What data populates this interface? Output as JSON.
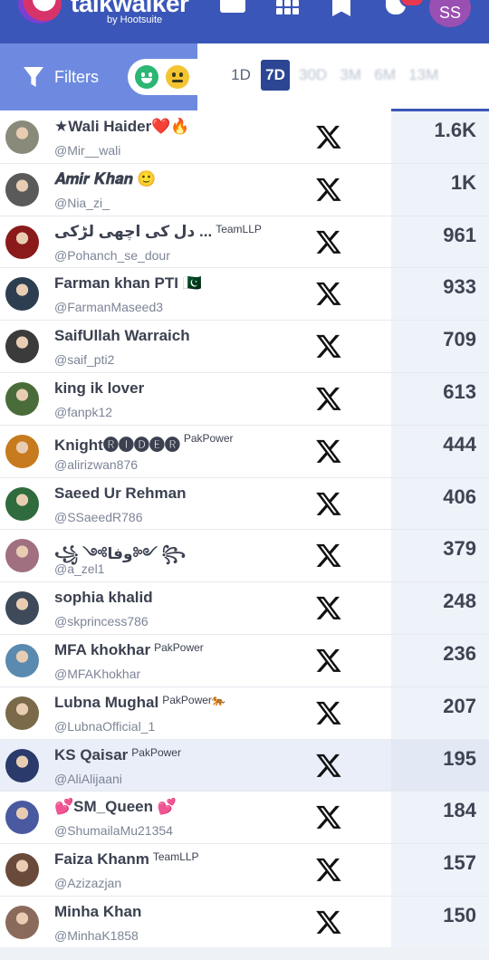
{
  "header": {
    "brand": "talkwalker",
    "brand_sub": "by Hootsuite",
    "avatar_initials": "SS"
  },
  "filters": {
    "label": "Filters",
    "ranges": [
      {
        "label": "1D",
        "state": "normal"
      },
      {
        "label": "7D",
        "state": "active"
      },
      {
        "label": "30D",
        "state": "muted"
      },
      {
        "label": "3M",
        "state": "muted"
      },
      {
        "label": "6M",
        "state": "muted"
      },
      {
        "label": "13M",
        "state": "muted"
      }
    ]
  },
  "colors": {
    "header_bg": "#3a56b8",
    "filter_panel_bg": "#6d8ae0",
    "active_range_bg": "#2c4694",
    "positive_sentiment": "#2bb673",
    "neutral_sentiment": "#f4c531"
  },
  "influencers": [
    {
      "name": "★Wali Haider❤️🔥",
      "extra": "",
      "handle": "@Mir__wali",
      "platform_icon": "x-icon",
      "value": "1.6K",
      "avatar_color": "#8a8a7a"
    },
    {
      "name": "𝑨𝒎𝒊𝒓 𝑲𝒉𝒂𝒏 🙂",
      "extra": "",
      "handle": "@Nia_zi_",
      "platform_icon": "x-icon",
      "value": "1K",
      "avatar_color": "#5a5a5a"
    },
    {
      "name": "دل کی اچھی لڑکی ...",
      "extra": "TeamLLP",
      "handle": "@Pohanch_se_dour",
      "platform_icon": "x-icon",
      "value": "961",
      "avatar_color": "#8b1a1a"
    },
    {
      "name": "Farman khan PTI 🇵🇰",
      "extra": "",
      "handle": "@FarmanMaseed3",
      "platform_icon": "x-icon",
      "value": "933",
      "avatar_color": "#2d3e50"
    },
    {
      "name": "SaifUllah Warraich",
      "extra": "",
      "handle": "@saif_pti2",
      "platform_icon": "x-icon",
      "value": "709",
      "avatar_color": "#3b3b3b"
    },
    {
      "name": "king ik lover",
      "extra": "",
      "handle": "@fanpk12",
      "platform_icon": "x-icon",
      "value": "613",
      "avatar_color": "#4a6b3a"
    },
    {
      "name": "Knight🅡🅘🅓🅔🅡",
      "extra": "PakPower",
      "handle": "@alirizwan876",
      "platform_icon": "x-icon",
      "value": "444",
      "avatar_color": "#c77a1e"
    },
    {
      "name": "Saeed Ur Rehman",
      "extra": "",
      "handle": "@SSaeedR786",
      "platform_icon": "x-icon",
      "value": "406",
      "avatar_color": "#2f6b3c"
    },
    {
      "name": "꧁ ༺وفا༻ ꧂",
      "extra": "",
      "handle": "@a_zel1",
      "platform_icon": "x-icon",
      "value": "379",
      "avatar_color": "#a07080"
    },
    {
      "name": "sophia khalid",
      "extra": "",
      "handle": "@skprincess786",
      "platform_icon": "x-icon",
      "value": "248",
      "avatar_color": "#3e4a5a"
    },
    {
      "name": "MFA khokhar",
      "extra": "PakPower",
      "handle": "@MFAKhokhar",
      "platform_icon": "x-icon",
      "value": "236",
      "avatar_color": "#5a8ab0"
    },
    {
      "name": "Lubna Mughal",
      "extra": "PakPower🐅",
      "handle": "@LubnaOfficial_1",
      "platform_icon": "x-icon",
      "value": "207",
      "avatar_color": "#7a6a4a"
    },
    {
      "name": "KS Qaisar",
      "extra": "PakPower",
      "handle": "@AliAlijaani",
      "platform_icon": "x-icon",
      "value": "195",
      "avatar_color": "#2a3a6a"
    },
    {
      "name": "💕SM_Queen 💕",
      "extra": "",
      "handle": "@ShumailaMu21354",
      "platform_icon": "x-icon",
      "value": "184",
      "avatar_color": "#4a5aa0"
    },
    {
      "name": "Faiza Khanm",
      "extra": "TeamLLP",
      "handle": "@Azizazjan",
      "platform_icon": "x-icon",
      "value": "157",
      "avatar_color": "#6a4a3a"
    },
    {
      "name": "Minha Khan",
      "extra": "",
      "handle": "@MinhaK1858",
      "platform_icon": "x-icon",
      "value": "150",
      "avatar_color": "#8a6a5a"
    }
  ]
}
